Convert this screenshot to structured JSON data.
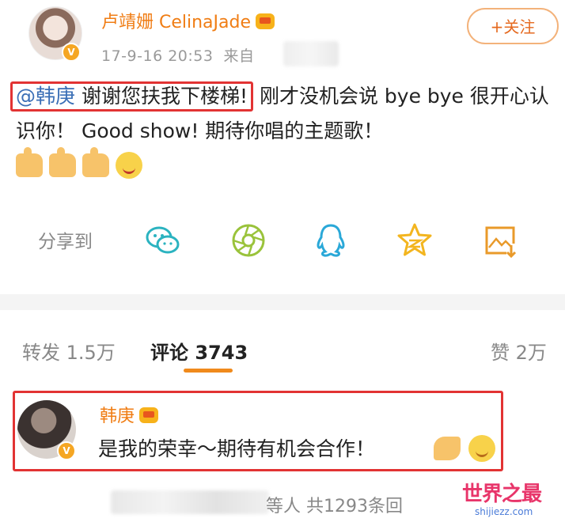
{
  "post": {
    "username": "卢靖姗 CelinaJade",
    "timestamp": "17-9-16 20:53",
    "source_prefix": "来自",
    "follow_label": "+关注",
    "mention": "@韩庚",
    "highlighted_text": "谢谢您扶我下楼梯!",
    "text_rest": "刚才没机会说 bye bye 很开心认识你！ Good show! 期待你唱的主题歌！",
    "emojis": [
      "thumbs-up",
      "thumbs-up",
      "thumbs-up",
      "tongue-smile"
    ]
  },
  "share": {
    "label": "分享到",
    "targets": [
      "wechat-icon",
      "moments-icon",
      "qq-icon",
      "qzone-icon",
      "save-image-icon"
    ]
  },
  "tabs": [
    {
      "label": "转发",
      "count": "1.5万"
    },
    {
      "label": "评论",
      "count": "3743"
    },
    {
      "label": "赞",
      "count": "2万"
    }
  ],
  "comment": {
    "username": "韩庚",
    "text": "是我的荣幸～期待有机会合作！",
    "emojis": [
      "clap-icon",
      "smile-icon"
    ]
  },
  "replies": {
    "text": "等人  共1293条回"
  },
  "watermark": {
    "title": "世界之最",
    "url": "shijiezz.com"
  },
  "colors": {
    "username": "#f07d14",
    "mention": "#3b6fb6",
    "highlight_box": "#e23333",
    "tab_underline": "#f08a1c"
  }
}
